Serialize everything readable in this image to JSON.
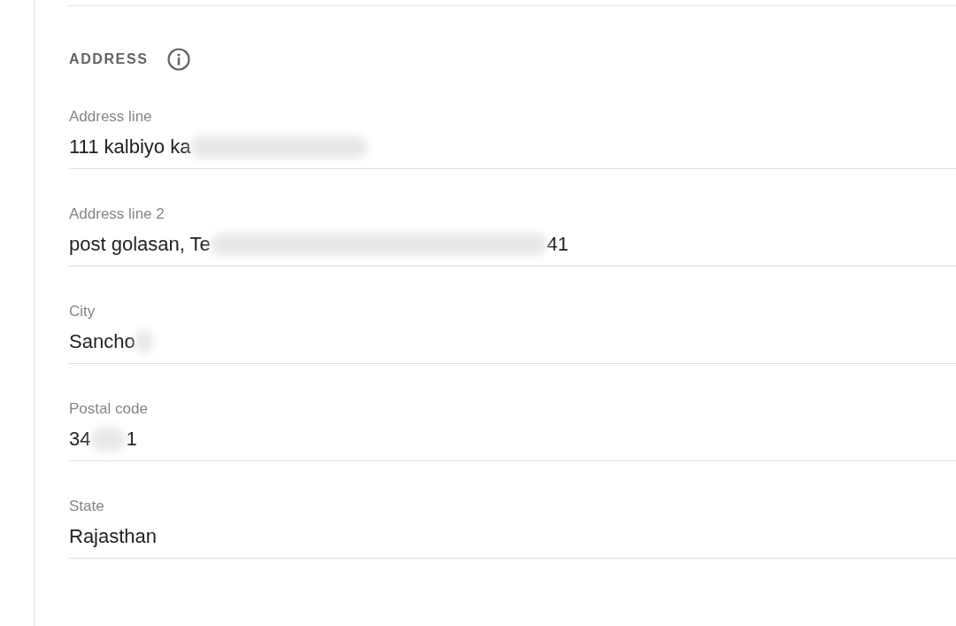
{
  "section": {
    "title": "ADDRESS"
  },
  "fields": [
    {
      "label": "Address line",
      "value": "111 kalbiyo ka",
      "redacted": true
    },
    {
      "label": "Address line 2",
      "value": "post golasan, Te",
      "redacted": true,
      "tail": "41"
    },
    {
      "label": "City",
      "value": "Sancho",
      "redacted": true
    },
    {
      "label": "Postal code",
      "value": "34",
      "redacted": true,
      "tail": "1"
    },
    {
      "label": "State",
      "value": "Rajasthan",
      "redacted": false
    }
  ]
}
